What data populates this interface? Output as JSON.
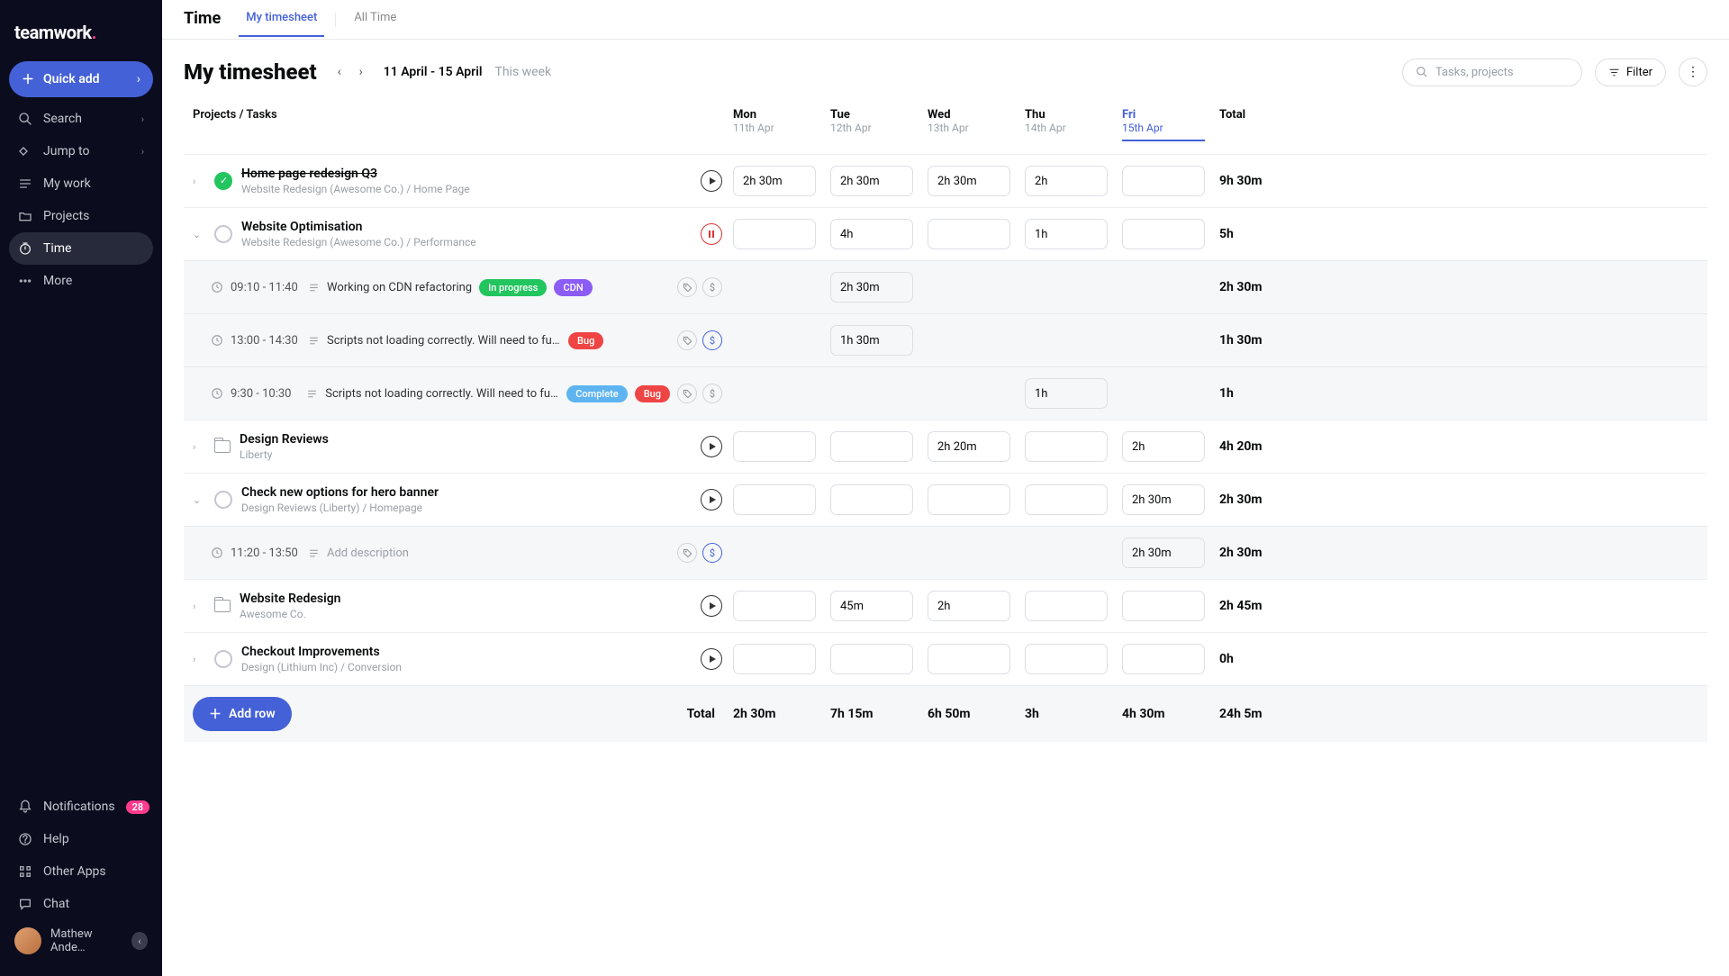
{
  "brand": "teamwork",
  "sidebar": {
    "quickAdd": "Quick add",
    "items": [
      {
        "label": "Search",
        "icon": "search"
      },
      {
        "label": "Jump to",
        "icon": "jump"
      },
      {
        "label": "My work",
        "icon": "mywork"
      },
      {
        "label": "Projects",
        "icon": "folder"
      },
      {
        "label": "Time",
        "icon": "time",
        "active": true
      },
      {
        "label": "More",
        "icon": "more"
      }
    ],
    "bottom": [
      {
        "label": "Notifications",
        "icon": "bell",
        "badge": "28"
      },
      {
        "label": "Help",
        "icon": "help"
      },
      {
        "label": "Other Apps",
        "icon": "grid"
      },
      {
        "label": "Chat",
        "icon": "chat"
      }
    ],
    "user": "Mathew Ande…"
  },
  "topbar": {
    "title": "Time",
    "tabs": [
      {
        "label": "My timesheet",
        "active": true
      },
      {
        "label": "All Time"
      }
    ]
  },
  "header": {
    "title": "My timesheet",
    "dateRange": "11 April - 15 April",
    "thisWeek": "This week",
    "searchPlaceholder": "Tasks, projects",
    "filter": "Filter"
  },
  "columns": {
    "projects": "Projects / Tasks",
    "days": [
      {
        "name": "Mon",
        "date": "11th Apr"
      },
      {
        "name": "Tue",
        "date": "12th Apr"
      },
      {
        "name": "Wed",
        "date": "13th Apr"
      },
      {
        "name": "Thu",
        "date": "14th Apr"
      },
      {
        "name": "Fri",
        "date": "15th Apr",
        "today": true
      }
    ],
    "total": "Total"
  },
  "rows": [
    {
      "type": "task",
      "expand": "right",
      "status": "done",
      "title": "Home page redesign Q3",
      "strike": true,
      "sub": "Website Redesign (Awesome Co.)  /  Home Page",
      "play": "play",
      "cells": [
        "2h 30m",
        "2h 30m",
        "2h 30m",
        "2h",
        ""
      ],
      "total": "9h 30m"
    },
    {
      "type": "task",
      "expand": "down",
      "status": "open",
      "title": "Website Optimisation",
      "sub": "Website Redesign (Awesome Co.)  /  Performance",
      "play": "pause",
      "cells": [
        "",
        "4h",
        "",
        "1h",
        ""
      ],
      "total": "5h"
    },
    {
      "type": "sub",
      "time": "09:10 - 11:40",
      "desc": "Working on CDN refactoring",
      "pills": [
        {
          "t": "In progress",
          "c": "green"
        },
        {
          "t": "CDN",
          "c": "purple"
        }
      ],
      "tag": true,
      "bill": false,
      "cells": [
        "",
        "2h 30m",
        "",
        "",
        ""
      ],
      "total": "2h 30m"
    },
    {
      "type": "sub",
      "time": "13:00 - 14:30",
      "desc": "Scripts not loading correctly. Will need to further investigate with back-…",
      "pills": [
        {
          "t": "Bug",
          "c": "red"
        }
      ],
      "tag": true,
      "bill": true,
      "cells": [
        "",
        "1h 30m",
        "",
        "",
        ""
      ],
      "total": "1h 30m"
    },
    {
      "type": "sub",
      "time": "9:30 - 10:30",
      "desc": "Scripts not loading correctly. Will need to further investiga…",
      "pills": [
        {
          "t": "Complete",
          "c": "blue"
        },
        {
          "t": "Bug",
          "c": "red"
        }
      ],
      "tag": true,
      "bill": false,
      "cells": [
        "",
        "",
        "",
        "1h",
        ""
      ],
      "total": "1h"
    },
    {
      "type": "project",
      "expand": "right",
      "title": "Design Reviews",
      "sub": "Liberty",
      "play": "play",
      "cells": [
        "",
        "",
        "2h 20m",
        "",
        "2h"
      ],
      "total": "4h 20m"
    },
    {
      "type": "task",
      "expand": "down",
      "status": "open",
      "title": "Check new options for hero banner",
      "sub": "Design Reviews (Liberty)  /  Homepage",
      "play": "play",
      "cells": [
        "",
        "",
        "",
        "",
        "2h 30m"
      ],
      "total": "2h 30m"
    },
    {
      "type": "sub",
      "time": "11:20 - 13:50",
      "desc": "Add description",
      "placeholder": true,
      "pills": [],
      "tag": true,
      "bill": true,
      "cells": [
        "",
        "",
        "",
        "",
        "2h 30m"
      ],
      "total": "2h 30m"
    },
    {
      "type": "project",
      "expand": "right",
      "title": "Website Redesign",
      "sub": "Awesome Co.",
      "play": "play",
      "cells": [
        "",
        "45m",
        "2h",
        "",
        ""
      ],
      "total": "2h 45m"
    },
    {
      "type": "task",
      "expand": "right",
      "status": "open",
      "title": "Checkout Improvements",
      "sub": "Design (Lithium Inc)  /  Conversion",
      "play": "play",
      "cells": [
        "",
        "",
        "",
        "",
        ""
      ],
      "total": "0h"
    }
  ],
  "footer": {
    "addRow": "Add row",
    "totalLabel": "Total",
    "dayTotals": [
      "2h 30m",
      "7h 15m",
      "6h 50m",
      "3h",
      "4h 30m"
    ],
    "grandTotal": "24h 5m"
  }
}
